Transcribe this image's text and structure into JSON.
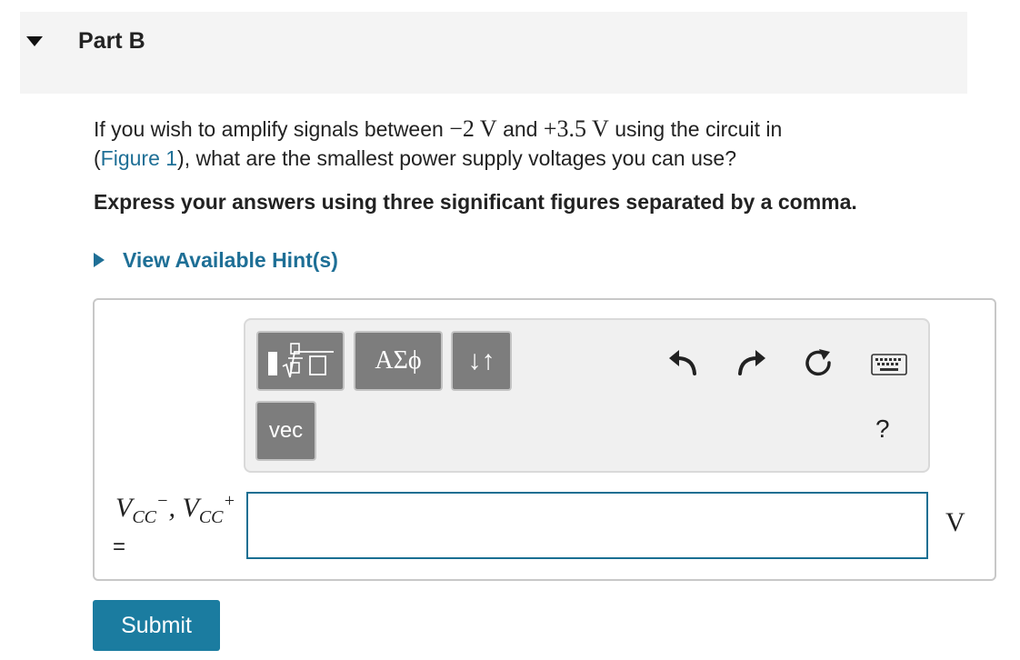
{
  "part": {
    "title": "Part B"
  },
  "question": {
    "text_a": "If you wish to amplify signals between ",
    "v_low": "−2 V",
    "text_b": " and ",
    "v_high": "+3.5 V",
    "text_c": " using the circuit in",
    "paren_open": "(",
    "figure_link": "Figure 1",
    "text_d": "), what are the smallest power supply voltages you can use?"
  },
  "instruction": "Express your answers using three significant figures separated by a comma.",
  "hint": {
    "label": "View Available Hint(s)"
  },
  "toolbar": {
    "greek_label": "ΑΣϕ",
    "arrows_label": "↓↑",
    "vec_label": "vec",
    "help_label": "?"
  },
  "answer": {
    "var1": "V",
    "var1_sub": "CC",
    "var1_sup": "−",
    "comma": ", ",
    "var2": "V",
    "var2_sub": "CC",
    "var2_sup": "+",
    "equals": "=",
    "value": "",
    "unit": "V"
  },
  "submit_label": "Submit",
  "colors": {
    "accent": "#1b7ca0",
    "link": "#1e6f96",
    "button_gray": "#7d7d7d"
  }
}
